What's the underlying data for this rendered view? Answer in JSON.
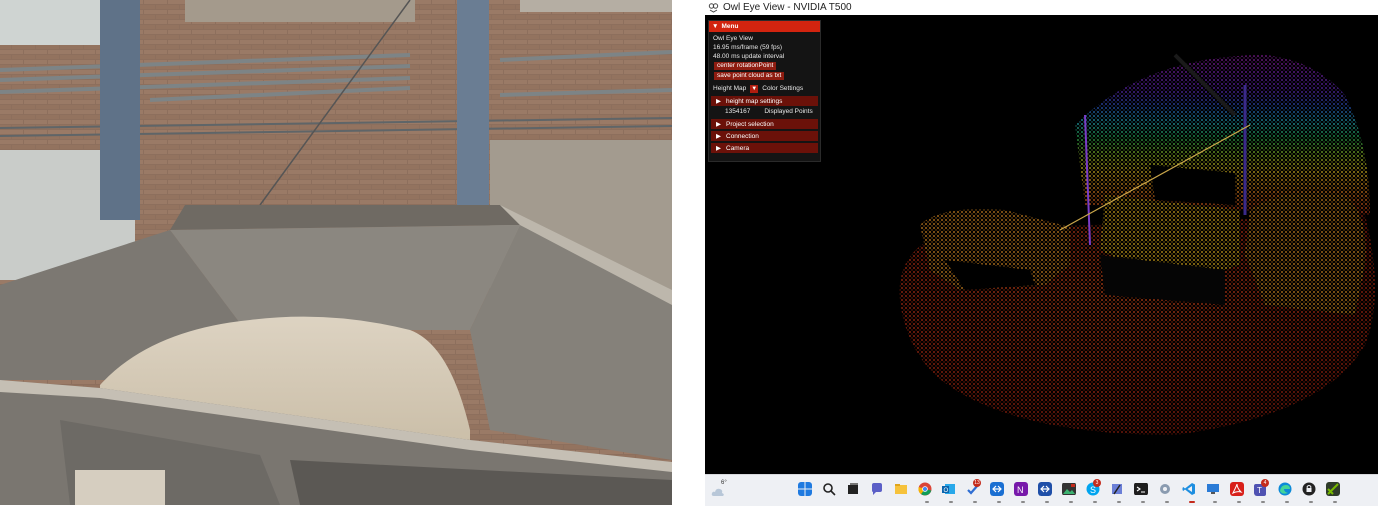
{
  "window": {
    "title": "Owl Eye View - NVIDIA T500"
  },
  "menu": {
    "header": "Menu",
    "app_name": "Owl Eye View",
    "frame_time": "16.95 ms/frame (59 fps)",
    "update_interval": "48.00 ms update interval",
    "center_button": "center rotationPoint",
    "save_button": "save point cloud as txt",
    "height_map_label": "Height Map",
    "color_settings_label": "Color Settings",
    "height_map_settings": "height map settings",
    "displayed_points_value": "1354167",
    "displayed_points_label": "Displayed Points",
    "project_selection": "Project selection",
    "connection": "Connection",
    "camera": "Camera"
  },
  "taskbar": {
    "temperature": "6°",
    "badges": {
      "teams": "13",
      "skype": "3",
      "pdf": "4"
    },
    "icons": [
      "windows-start",
      "search",
      "task-view",
      "chat",
      "file-explorer",
      "chrome",
      "outlook",
      "teams",
      "teamviewer",
      "onenote",
      "teamviewer-2",
      "photos",
      "skype",
      "paint",
      "terminal",
      "settings",
      "vscode",
      "remote-desktop",
      "acrobat",
      "teams-2",
      "edge",
      "security",
      "nvidia"
    ]
  },
  "colors": {
    "menu_header": "#d2240f",
    "menu_button": "#8e1c10",
    "menu_section": "#6b1109",
    "viewport_bg": "#000000"
  }
}
